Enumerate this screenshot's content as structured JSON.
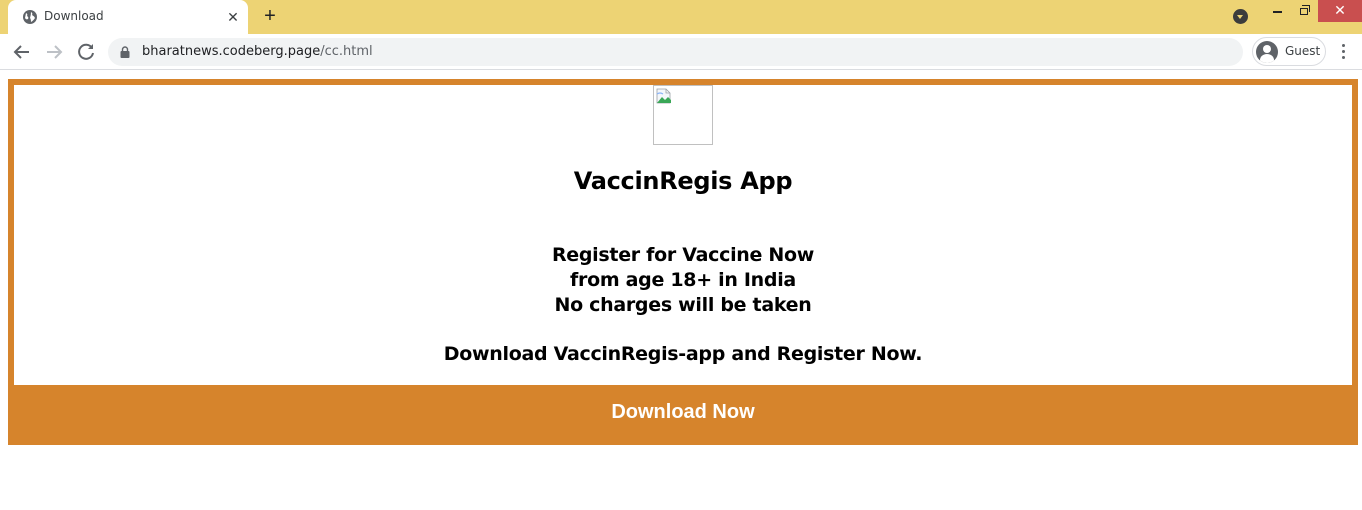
{
  "browser": {
    "tab": {
      "title": "Download",
      "favicon": "globe-icon"
    },
    "new_tab_label": "+",
    "window_controls": {
      "minimize": "minimize-icon",
      "maximize": "restore-icon",
      "close": "close-icon"
    },
    "toolbar": {
      "url_host": "bharatnews.codeberg.page",
      "url_path": "/cc.html",
      "profile_name": "Guest"
    },
    "colors": {
      "tabstrip": "#edd374",
      "close_button": "#c94f4f"
    }
  },
  "page": {
    "image": {
      "alt": "",
      "state": "broken-image"
    },
    "title": "VaccinRegis App",
    "lines": [
      "Register for Vaccine Now",
      "from age 18+ in India",
      "No charges will be taken"
    ],
    "cta_text": "Download VaccinRegis-app and Register Now.",
    "download_button": "Download Now",
    "colors": {
      "accent": "#d6842c"
    }
  }
}
